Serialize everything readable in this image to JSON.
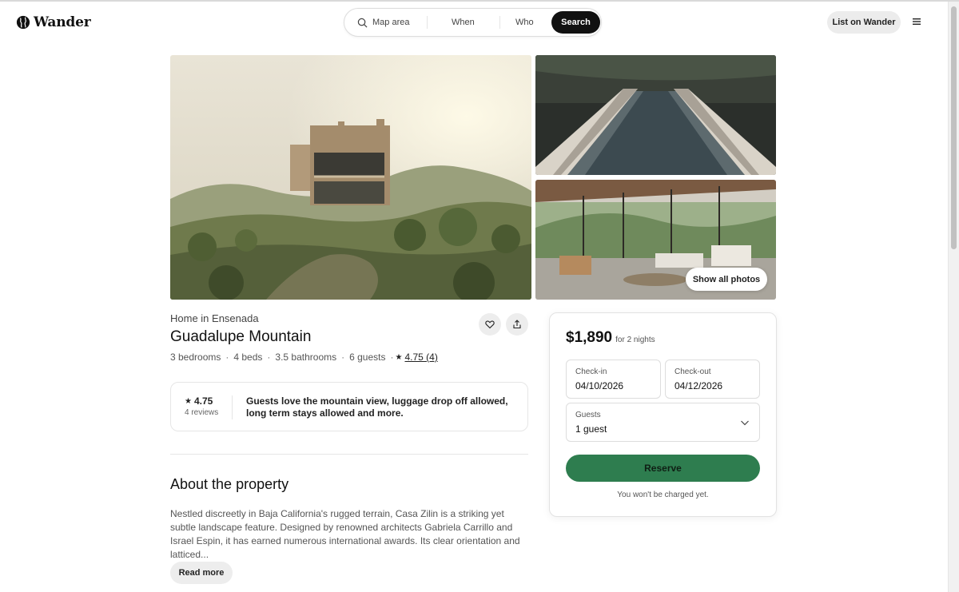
{
  "header": {
    "brand": "Wander",
    "search": {
      "map_label": "Map area",
      "when_label": "When",
      "who_label": "Who",
      "search_label": "Search"
    },
    "list_label": "List on Wander",
    "icons": {
      "logo": "globe-icon",
      "search": "search-icon",
      "menu": "hamburger-menu-icon"
    }
  },
  "gallery": {
    "show_all_label": "Show all photos"
  },
  "listing": {
    "subtitle": "Home in Ensenada",
    "title": "Guadalupe Mountain",
    "facts": {
      "bedrooms": "3 bedrooms",
      "beds": "4 beds",
      "bathrooms": "3.5 bathrooms",
      "guests": "6 guests",
      "rating": "4.75 (4)"
    },
    "review_card": {
      "rating": "4.75",
      "count": "4 reviews",
      "summary": "Guests love the mountain view, luggage drop off allowed, long term stays allowed and more."
    },
    "about": {
      "title": "About the property",
      "text": "Nestled discreetly in Baja California's rugged terrain, Casa Zilin is a striking yet subtle landscape feature. Designed by renowned architects Gabriela Carrillo and Israel Espin, it has earned numerous international awards. Its clear orientation and latticed...",
      "read_more_label": "Read more"
    },
    "icons": {
      "favorite": "heart-icon",
      "share": "share-icon",
      "star": "star-icon"
    }
  },
  "booking": {
    "price": "$1,890",
    "price_note": "for 2 nights",
    "checkin_label": "Check-in",
    "checkin_value": "04/10/2026",
    "checkout_label": "Check-out",
    "checkout_value": "04/12/2026",
    "guests_label": "Guests",
    "guests_value": "1 guest",
    "reserve_label": "Reserve",
    "charge_note": "You won't be charged yet."
  },
  "colors": {
    "accent_green": "#2e7d4f",
    "search_button": "#111111",
    "pill_gray": "#ececec"
  }
}
